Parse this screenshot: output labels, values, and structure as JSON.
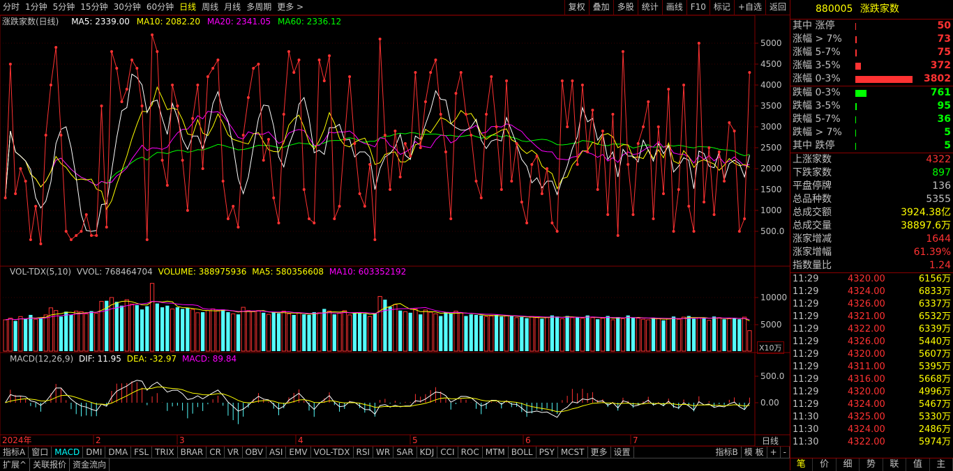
{
  "top": {
    "periods": [
      "分时",
      "1分钟",
      "5分钟",
      "15分钟",
      "30分钟",
      "60分钟",
      "日线",
      "周线",
      "月线",
      "多周期",
      "更多 >"
    ],
    "active_period": 6,
    "tools": [
      "复权",
      "叠加",
      "多股",
      "统计",
      "画线",
      "F10",
      "标记",
      "+自选",
      "返回"
    ]
  },
  "main": {
    "name": "涨跌家数(日线)",
    "ma5": "MA5: 2339.00",
    "ma10": "MA10: 2082.20",
    "ma20": "MA20: 2341.05",
    "ma60": "MA60: 2336.12",
    "axis": [
      "5000",
      "4500",
      "4000",
      "3500",
      "3000",
      "2500",
      "2000",
      "1500",
      "1000",
      "500.0"
    ]
  },
  "vol": {
    "name": "VOL-TDX(5,10)",
    "vvol": "VVOL: 768464704",
    "volume": "VOLUME: 388975936",
    "ma5": "MA5: 580356608",
    "ma10": "MA10: 603352192",
    "axis": [
      "10000",
      "5000"
    ],
    "unit": "X10万"
  },
  "macd": {
    "name": "MACD(12,26,9)",
    "dif": "DIF: 11.95",
    "dea": "DEA: -32.97",
    "macd": "MACD: 89.84",
    "axis": [
      "500.0",
      "0.00"
    ]
  },
  "xaxis": {
    "labels": [
      "2024年",
      "2",
      "3",
      "4",
      "5",
      "6",
      "7"
    ],
    "period": "日线"
  },
  "colors": {
    "up": "#ff3232",
    "down": "#54fcfc",
    "ma5": "#ffffff",
    "ma10": "#ffff00",
    "ma20": "#ff00ff",
    "ma60": "#00ff00",
    "grid": "#800000"
  },
  "panel": {
    "code": "880005",
    "title": "涨跌家数",
    "dist": [
      {
        "label": "其中 涨停",
        "value": "50",
        "color": "#ff3232",
        "frac": 0.013
      },
      {
        "label": "涨幅 > 7%",
        "value": "73",
        "color": "#ff3232",
        "frac": 0.019
      },
      {
        "label": "涨幅 5-7%",
        "value": "75",
        "color": "#ff3232",
        "frac": 0.02
      },
      {
        "label": "涨幅 3-5%",
        "value": "372",
        "color": "#ff3232",
        "frac": 0.098
      },
      {
        "label": "涨幅 0-3%",
        "value": "3802",
        "color": "#ff3232",
        "frac": 1.0
      },
      {
        "label": "跌幅 0-3%",
        "value": "761",
        "color": "#00ff00",
        "frac": 0.2
      },
      {
        "label": "跌幅 3-5%",
        "value": "95",
        "color": "#00ff00",
        "frac": 0.025
      },
      {
        "label": "跌幅 5-7%",
        "value": "36",
        "color": "#00ff00",
        "frac": 0.01
      },
      {
        "label": "跌幅 > 7%",
        "value": "5",
        "color": "#00ff00",
        "frac": 0.002
      },
      {
        "label": "其中 跌停",
        "value": "5",
        "color": "#00ff00",
        "frac": 0.002
      }
    ],
    "stats": [
      {
        "label": "上涨家数",
        "value": "4322",
        "color": "#ff3232"
      },
      {
        "label": "下跌家数",
        "value": "897",
        "color": "#00ff00"
      },
      {
        "label": "平盘停牌",
        "value": "136",
        "color": "#c0c0c0"
      },
      {
        "label": "总品种数",
        "value": "5355",
        "color": "#c0c0c0"
      },
      {
        "label": "总成交额",
        "value": "3924.38亿",
        "color": "#ffff00"
      },
      {
        "label": "总成交量",
        "value": "38897.6万",
        "color": "#ffff00"
      },
      {
        "label": "涨家增减",
        "value": "1644",
        "color": "#ff3232"
      },
      {
        "label": "涨家增幅",
        "value": "61.39%",
        "color": "#ff3232"
      },
      {
        "label": "指数量比",
        "value": "1.24",
        "color": "#ff3232"
      }
    ],
    "ticks": [
      {
        "t": "11:29",
        "p": "4320.00",
        "v": "6156万"
      },
      {
        "t": "11:29",
        "p": "4324.00",
        "v": "6833万"
      },
      {
        "t": "11:29",
        "p": "4326.00",
        "v": "6337万"
      },
      {
        "t": "11:29",
        "p": "4321.00",
        "v": "6532万"
      },
      {
        "t": "11:29",
        "p": "4322.00",
        "v": "6339万"
      },
      {
        "t": "11:29",
        "p": "4326.00",
        "v": "5440万"
      },
      {
        "t": "11:29",
        "p": "4320.00",
        "v": "5607万"
      },
      {
        "t": "11:29",
        "p": "4311.00",
        "v": "5395万"
      },
      {
        "t": "11:29",
        "p": "4316.00",
        "v": "5668万"
      },
      {
        "t": "11:29",
        "p": "4320.00",
        "v": "4996万"
      },
      {
        "t": "11:29",
        "p": "4324.00",
        "v": "5467万"
      },
      {
        "t": "11:30",
        "p": "4325.00",
        "v": "5330万"
      },
      {
        "t": "11:30",
        "p": "4324.00",
        "v": "2486万"
      },
      {
        "t": "11:30",
        "p": "4322.00",
        "v": "5974万"
      }
    ],
    "bottom": [
      "笔",
      "价",
      "细",
      "势",
      "联",
      "值",
      "主"
    ]
  },
  "indicator_tabs": [
    "指标A",
    "窗口",
    "MACD",
    "DMI",
    "DMA",
    "FSL",
    "TRIX",
    "BRAR",
    "CR",
    "VR",
    "OBV",
    "ASI",
    "EMV",
    "VOL-TDX",
    "RSI",
    "WR",
    "SAR",
    "KDJ",
    "CCI",
    "ROC",
    "MTM",
    "BOLL",
    "PSY",
    "MCST",
    "更多",
    "设置"
  ],
  "active_indicator": 2,
  "right_tabs": [
    "指标B",
    "模 板",
    "+",
    "-"
  ],
  "bottom_tabs": [
    "扩展^",
    "关联报价",
    "资金流向"
  ],
  "chart_data": {
    "type": "line",
    "main_series": [
      1300,
      4500,
      1400,
      2000,
      1700,
      300,
      1100,
      200,
      2800,
      4000,
      4900,
      2800,
      500,
      300,
      400,
      500,
      900,
      400,
      400,
      3500,
      600,
      4800,
      4400,
      3600,
      3900,
      4600,
      4400,
      3500,
      300,
      5200,
      4800,
      2200,
      1600,
      4000,
      3500,
      2200,
      1000,
      3200,
      4000,
      2000,
      4200,
      4400,
      4600,
      1700,
      800,
      1100,
      600,
      2800,
      3700,
      4400,
      4500,
      2200,
      2700,
      1300,
      700,
      3300,
      4800,
      4300,
      4600,
      1500,
      800,
      700,
      4600,
      4100,
      4700,
      800,
      1100,
      2700,
      4200,
      2600,
      1400,
      1100,
      2100,
      300,
      5100,
      2800,
      1500,
      2900,
      1800,
      2600,
      2300,
      4300,
      2500,
      3600,
      4300,
      4600,
      3300,
      2400,
      800,
      3800,
      4300,
      3300,
      2800,
      1700,
      1300,
      3300,
      4200,
      3000,
      1500,
      4100,
      1700,
      2600,
      1200,
      700,
      2100,
      2300,
      1400,
      2000,
      700,
      500,
      4100,
      3000,
      4100,
      2100,
      4000,
      2400,
      3400,
      1500,
      2900,
      900,
      3300,
      400,
      4800,
      2100,
      900,
      2600,
      3000,
      3600,
      800,
      3000,
      1400,
      3900,
      500,
      1500,
      4000,
      1100,
      500,
      5000,
      1200,
      2500,
      900,
      2400,
      1700,
      3100,
      2900,
      500,
      800,
      4300
    ],
    "vol_series": [
      5900,
      6200,
      5700,
      6500,
      6100,
      6800,
      6000,
      6200,
      6800,
      8100,
      7600,
      6500,
      7400,
      6800,
      7500,
      7400,
      7000,
      7500,
      7100,
      9300,
      9400,
      10000,
      9200,
      8500,
      9600,
      8800,
      8600,
      7800,
      8400,
      12600,
      8900,
      8200,
      8500,
      7900,
      8200,
      7900,
      8100,
      7800,
      7200,
      7300,
      7600,
      7900,
      7600,
      7800,
      7300,
      7000,
      6900,
      8200,
      7600,
      7400,
      7600,
      7200,
      6900,
      7300,
      7100,
      7500,
      7000,
      6800,
      7200,
      6900,
      6800,
      7300,
      7200,
      7900,
      7500,
      6900,
      7100,
      7600,
      6800,
      7200,
      7100,
      7000,
      6500,
      7100,
      10200,
      9600,
      8300,
      8700,
      7600,
      7400,
      7200,
      7900,
      6900,
      7700,
      7300,
      7000,
      6600,
      7300,
      7100,
      7500,
      7200,
      6600,
      6900,
      6800,
      6700,
      6500,
      6600,
      6800,
      6500,
      6700,
      6600,
      6300,
      6400,
      6200,
      6500,
      6300,
      6100,
      6400,
      6700,
      6500,
      6100,
      6600,
      6300,
      6400,
      6200,
      6700,
      6300,
      6000,
      6200,
      6600,
      5900,
      6400,
      6100,
      6700,
      6300,
      6200,
      6000,
      5900,
      6300,
      6100,
      5800,
      6100,
      6500,
      6000,
      6400,
      6600,
      6100,
      6300,
      6200,
      5800,
      6500,
      6300,
      6000,
      6100,
      6200,
      6000,
      6400,
      3900
    ]
  }
}
